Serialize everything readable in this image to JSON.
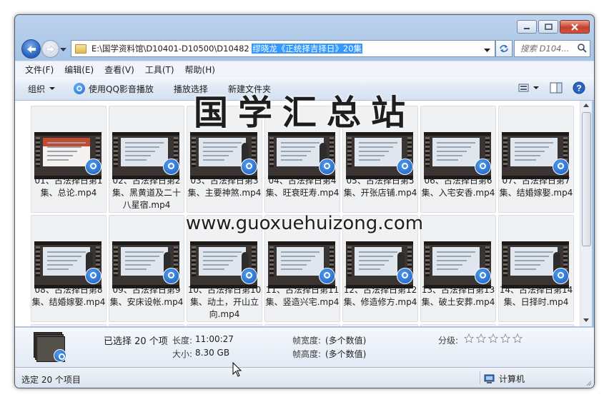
{
  "window": {
    "address_path": "E:\\国学资料馆\\D10401-D10500\\D10482 ",
    "address_selected": "缪晓龙《正统择吉择日》20集",
    "search_placeholder": "搜索 D104..."
  },
  "menu": [
    "文件(F)",
    "编辑(E)",
    "查看(V)",
    "工具(T)",
    "帮助(H)"
  ],
  "toolbar": {
    "organize": "组织",
    "play_qq": "使用QQ影音播放",
    "play_selection": "播放选择",
    "new_folder": "新建文件夹"
  },
  "files": [
    {
      "label": "01、古法择日第1集、总论.mp4",
      "thumb": "red",
      "person": false
    },
    {
      "label": "02、古法择日第2集、黑黄道及二十八星宿.mp4",
      "thumb": "text",
      "person": false
    },
    {
      "label": "03、古法择日第3集、主要神煞.mp4",
      "thumb": "text",
      "person": true
    },
    {
      "label": "04、古法择日第4集、旺衰旺寿.mp4",
      "thumb": "text",
      "person": true
    },
    {
      "label": "05、古法择日第5集、开张店铺.mp4",
      "thumb": "text",
      "person": false
    },
    {
      "label": "06、古法择日第6集、入宅安香.mp4",
      "thumb": "text",
      "person": false
    },
    {
      "label": "07、古法择日第7集、结婚嫁娶.mp4",
      "thumb": "text",
      "person": false
    },
    {
      "label": "08、古法择日第8集、结婚嫁娶.mp4",
      "thumb": "text",
      "person": true
    },
    {
      "label": "09、古法择日第9集、安床设帐.mp4",
      "thumb": "text",
      "person": true
    },
    {
      "label": "10、古法择日第10集、动土，开山立向.mp4",
      "thumb": "text",
      "person": true
    },
    {
      "label": "11、古法择日第11集、竖造兴宅.mp4",
      "thumb": "text",
      "person": false
    },
    {
      "label": "12、古法择日第12集、修造修方.mp4",
      "thumb": "text",
      "person": true
    },
    {
      "label": "13、古法择日第13集、破土安葬.mp4",
      "thumb": "text",
      "person": false
    },
    {
      "label": "14、古法择日第14集、日择时.mp4",
      "thumb": "text",
      "person": true
    }
  ],
  "watermark": {
    "title": "国学汇总站",
    "url": "www.guoxuehuizong.com"
  },
  "details": {
    "selected": "已选择 20 个项",
    "length_label": "长度:",
    "length_value": "11:00:27",
    "size_label": "大小:",
    "size_value": "8.30 GB",
    "fwidth_label": "帧宽度:",
    "fwidth_value": "(多个数值)",
    "fheight_label": "帧高度:",
    "fheight_value": "(多个数值)",
    "rating_label": "分级:",
    "rating_stars": 0
  },
  "status": {
    "text": "选定 20 个项目",
    "computer": "计算机"
  }
}
